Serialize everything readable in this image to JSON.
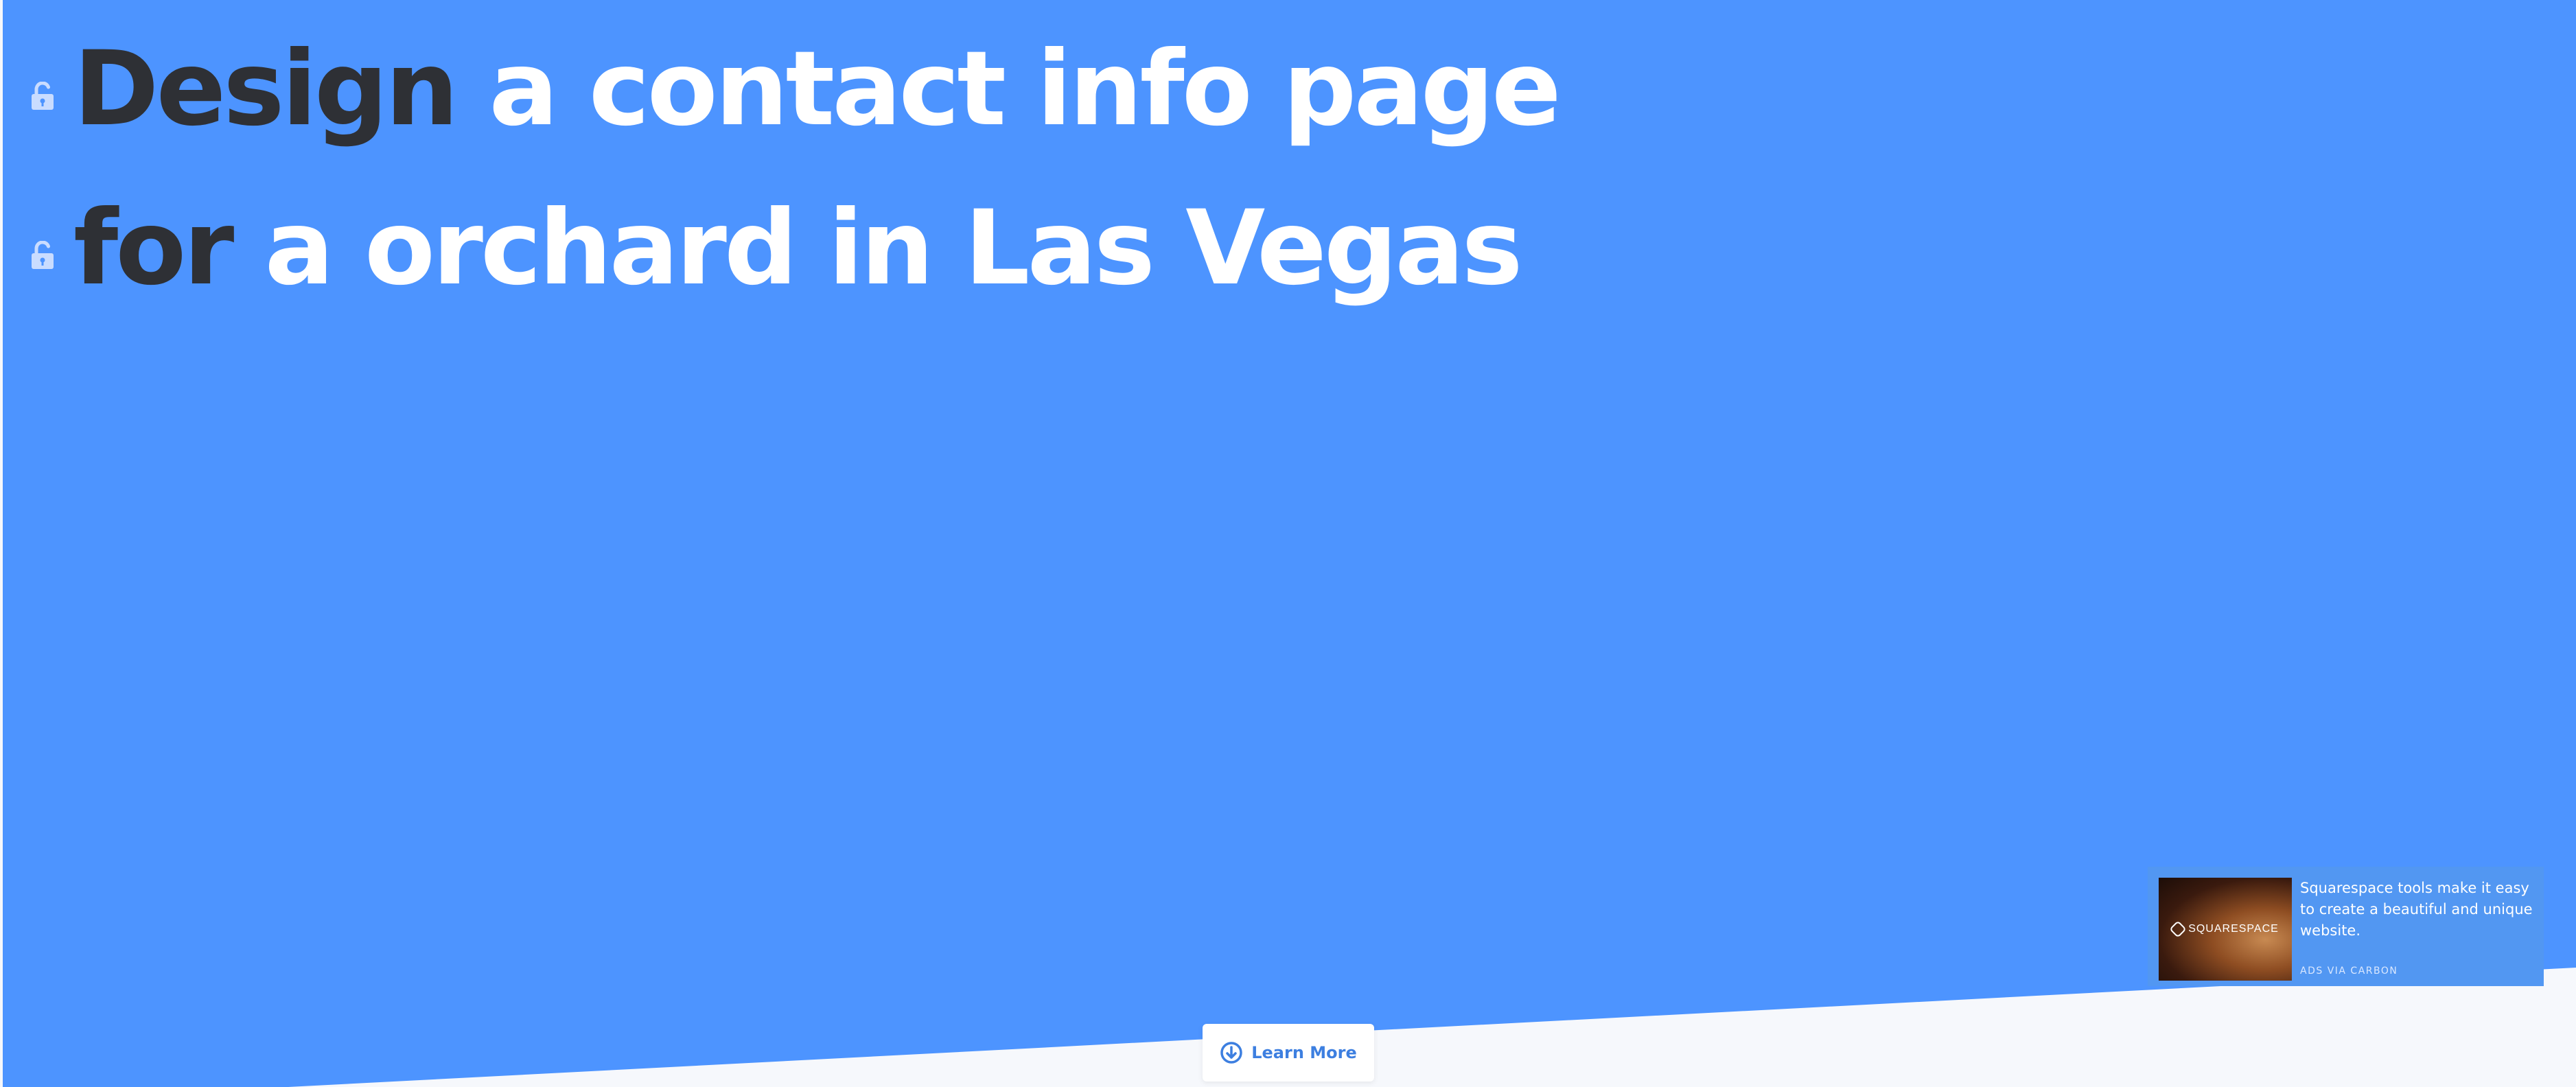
{
  "hero": {
    "line1": {
      "verb": "Design",
      "rest": "a contact info page"
    },
    "line2": {
      "verb": "for",
      "rest": "a orchard in Las Vegas"
    },
    "lock_icon": "unlocked-padlock-icon"
  },
  "ad": {
    "brand": "SQUARESPACE",
    "copy": "Squarespace tools make it easy to create a beautiful and unique website.",
    "via": "ADS VIA CARBON"
  },
  "cta": {
    "label": "Learn More",
    "icon": "arrow-down-circle-icon"
  },
  "colors": {
    "background": "#4d94ff",
    "dark_text": "#2e3035",
    "light_area": "#f6f8fc",
    "button_text": "#3d7fe0"
  }
}
